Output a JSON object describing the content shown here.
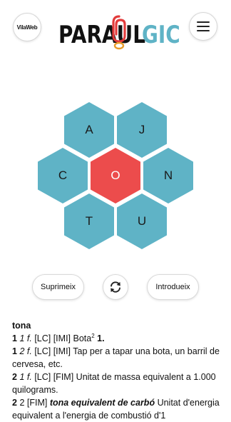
{
  "header": {
    "vilaweb_logo_text": "VilaWeb",
    "vilaweb_logo_icon": "vilaweb-logo",
    "game_title": {
      "part1": "PARAUL",
      "part2": "GIC"
    },
    "clip_icon": "paperclip-icon",
    "menu_icon": "hamburger-menu-icon"
  },
  "board": {
    "center_letter": "O",
    "outer_letters": [
      "A",
      "J",
      "C",
      "N",
      "T",
      "U"
    ]
  },
  "colors": {
    "outer_hex": "#5fb3c6",
    "center_hex": "#ec4c4c",
    "logo_black": "#111111",
    "logo_teal": "#5fb3c6",
    "clip_red": "#e23b3b"
  },
  "controls": {
    "delete_label": "Suprimeix",
    "shuffle_icon": "shuffle-arrows-icon",
    "enter_label": "Introdueix"
  },
  "definition": {
    "headword": "tona",
    "entries": [
      {
        "num": "1",
        "sub": "1",
        "pos": "f.",
        "tags": "[LC] [IMI]",
        "text": "Bota",
        "sup": "2",
        "ref": "1."
      },
      {
        "num": "1",
        "sub": "2",
        "pos": "f.",
        "tags": "[LC] [IMI]",
        "text": "Tap per a tapar una bota, un barril de cervesa, etc."
      },
      {
        "num": "2",
        "sub": "1",
        "pos": "f.",
        "tags": "[LC] [FIM]",
        "text": "Unitat de massa equivalent a 1.000 quilograms."
      },
      {
        "num": "2",
        "sub": "2",
        "tags": "[FIM]",
        "bold": "tona equivalent de carbó",
        "text": "Unitat d'energia equivalent a l'energia de combustió d'1"
      }
    ]
  }
}
